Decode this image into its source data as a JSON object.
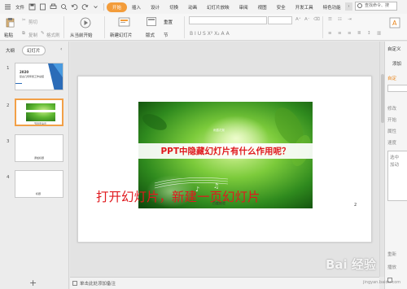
{
  "menu": {
    "file_label": "文件",
    "tabs": [
      "开始",
      "插入",
      "设计",
      "切换",
      "动画",
      "幻灯片放映",
      "审阅",
      "视图",
      "安全",
      "开发工具",
      "特色功能"
    ],
    "active_tab": "开始",
    "search_placeholder": "查找命令、搜"
  },
  "ribbon": {
    "paste_label": "粘贴",
    "cut_label": "剪切",
    "copy_label": "复制",
    "format_painter_label": "格式刷",
    "from_current_label": "从当前开始",
    "new_slide_label": "新建幻灯片",
    "layout_label": "版式",
    "reset_label": "重置",
    "section_label": "节",
    "font_buttons": "B  I  U  S  X²  X₂  A  A"
  },
  "left_pane": {
    "outline_tab": "大纲",
    "slides_tab": "幻灯片",
    "slide_numbers": [
      "1",
      "2",
      "3",
      "4"
    ],
    "slide1_title": "2020",
    "slide1_subtitle": "复古几何年终工作总结",
    "slide2_footer": "节目页演示",
    "slide3_footer": "添加标题",
    "slide4_footer": "标题"
  },
  "slide": {
    "title": "PPT中隐藏幻灯片有什么作用呢？",
    "caption": "雨露花絮",
    "footer": "百度经验",
    "number": "2"
  },
  "annotation": "打开幻灯片，新建一页幻灯片",
  "notes": {
    "placeholder": "单击此处添加备注"
  },
  "right_pane": {
    "header": "自定义",
    "add_effect": "添加",
    "custom_label": "自定",
    "modify_label": "修改",
    "start_label": "开始",
    "property_label": "属性",
    "speed_label": "速度",
    "list_text_1": "选中",
    "list_text_2": "加动",
    "reorder_label": "重新",
    "play_label": "播放"
  },
  "watermark": {
    "logo": "Bai 经验",
    "url": "jingyan.baidu.com"
  },
  "colors": {
    "accent": "#f39c3a",
    "annotation_red": "#e0191e",
    "selected_thumb_border": "#f2a047"
  }
}
